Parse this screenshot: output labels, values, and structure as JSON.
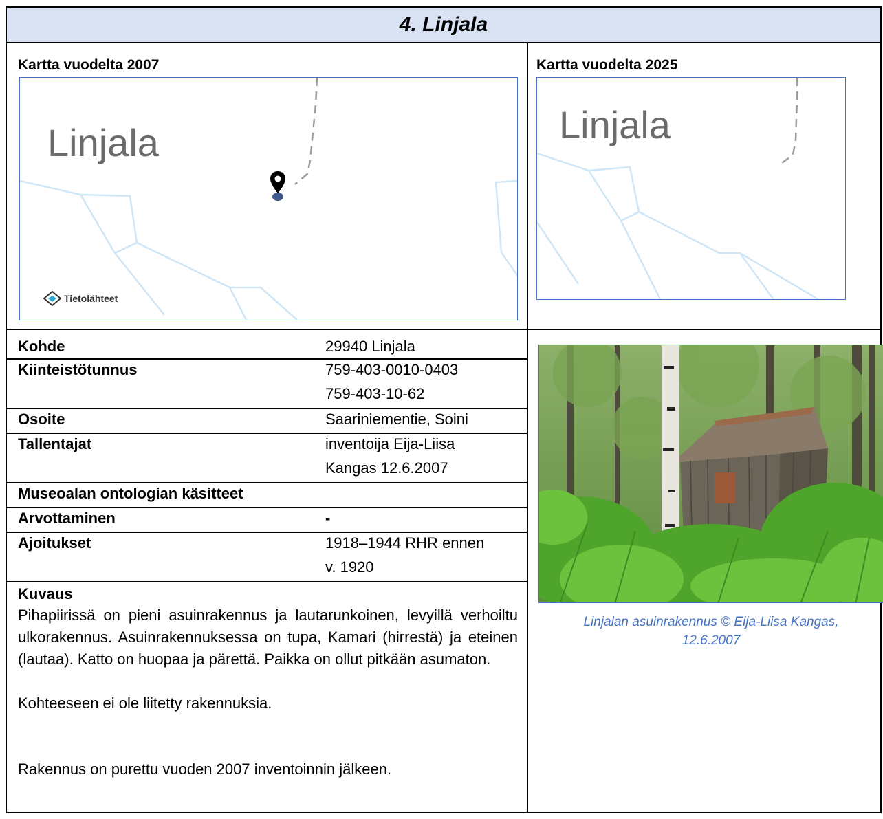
{
  "title": "4. Linjala",
  "map_2007": {
    "heading": "Kartta vuodelta 2007",
    "place_label": "Linjala",
    "watermark": "Tietolähteet"
  },
  "map_2025": {
    "heading": "Kartta vuodelta 2025",
    "place_label": "Linjala"
  },
  "fields": [
    {
      "label": "Kohde",
      "value": "29940 Linjala"
    },
    {
      "label": "Kiinteistötunnus",
      "value_lines": [
        "759-403-0010-0403",
        "759-403-10-62"
      ]
    },
    {
      "label": "Osoite",
      "value": "Saariniementie, Soini"
    },
    {
      "label": "Tallentajat",
      "value_lines": [
        "inventoija Eija-Liisa",
        "Kangas 12.6.2007"
      ]
    },
    {
      "label": "Museoalan ontologian käsitteet",
      "value": ""
    },
    {
      "label": "Arvottaminen",
      "value": "-"
    },
    {
      "label": "Ajoitukset",
      "value_lines": [
        "1918–1944 RHR ennen",
        "v. 1920"
      ]
    }
  ],
  "description": {
    "heading": "Kuvaus",
    "paragraphs": [
      "Pihapiirissä on pieni asuinrakennus ja lautarunkoinen, levyillä verhoiltu ulkorakennus. Asuinrakennuksessa on tupa, Kamari (hirrestä) ja eteinen (lautaa). Katto on huopaa ja pärettä. Paikka on ollut pitkään asumaton.",
      "Kohteeseen ei ole liitetty rakennuksia.",
      "Rakennus on purettu vuoden 2007 inventoinnin jälkeen."
    ]
  },
  "photo": {
    "caption_line1": "Linjalan asuinrakennus © Eija-Liisa Kangas,",
    "caption_line2": "12.6.2007"
  },
  "colors": {
    "header_bg": "#d9e2f3",
    "frame_blue": "#4472c4",
    "stream": "#cfe6f6",
    "caption": "#4472c4"
  }
}
